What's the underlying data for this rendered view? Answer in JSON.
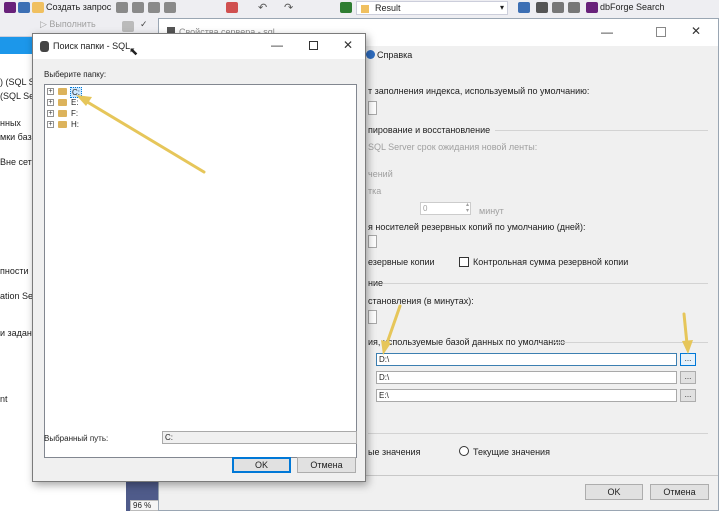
{
  "ssms": {
    "toolbar": {
      "new_query": "Создать запрос",
      "execute": "Выполнить",
      "result_dropdown": "Result",
      "dbforge_search": "dbForge Search"
    },
    "left_panel": {
      "rows": [
        ") (SQL Se",
        "(SQL Se",
        "нных",
        "мки баз",
        "Вне сет",
        "пности",
        "ation Ser",
        "и задан",
        "nt"
      ]
    },
    "zoom": "96 %"
  },
  "server_dialog": {
    "title": "Свойства сервера - sql",
    "help": "Справка",
    "fill_factor_label": "т заполнения индекса, используемый по умолчанию:",
    "backup_section": "пирование и восстановление",
    "tape_timeout_label": "SQL Server срок ожидания новой ленты:",
    "muted_1": "чений",
    "muted_2": "тка",
    "minutes_value": "0",
    "minutes_label": "минут",
    "retention_label": "я носителей резервных копий по умолчанию (дней):",
    "compress_label": "езервные копии",
    "checksum_label": "Контрольная сумма резервной копии",
    "recovery_section": "ние",
    "recovery_label": "становления (в минутах):",
    "locations_section": "ия, используемые базой данных по умолчанию",
    "path_data": "D:\\",
    "path_log": "D:\\",
    "path_backup": "E:\\",
    "browse_label": "...",
    "configured_values": "ые значения",
    "running_values": "Текущие значения",
    "ok": "OK",
    "cancel": "Отмена"
  },
  "folder_dialog": {
    "title": "Поиск папки - SQL",
    "prompt": "Выберите папку:",
    "tree": [
      {
        "label": "C:",
        "selected": true
      },
      {
        "label": "E:",
        "selected": false
      },
      {
        "label": "F:",
        "selected": false
      },
      {
        "label": "H:",
        "selected": false
      }
    ],
    "expander": "+",
    "selected_path_label": "Выбранный путь:",
    "selected_path_value": "C:",
    "ok": "OK",
    "cancel": "Отмена"
  },
  "colors": {
    "accent": "#0078d7",
    "arrow": "#e6c65a",
    "folder": "#dcb35c"
  }
}
